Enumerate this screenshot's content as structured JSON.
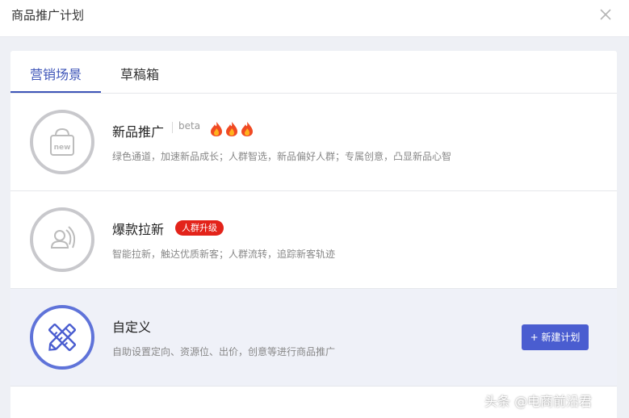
{
  "header": {
    "title": "商品推广计划",
    "close_icon": "close-icon"
  },
  "tabs": [
    {
      "label": "营销场景",
      "active": true
    },
    {
      "label": "草稿箱",
      "active": false
    }
  ],
  "scenarios": [
    {
      "title": "新品推广",
      "tag": "beta",
      "icon": "new-bag-icon",
      "hot_icons": [
        "fire-icon",
        "fire-icon",
        "fire-icon"
      ],
      "desc": "绿色通道，加速新品成长；人群智选，新品偏好人群；专属创意，凸显新品心智"
    },
    {
      "title": "爆款拉新",
      "badge": "人群升级",
      "icon": "user-flow-icon",
      "desc": "智能拉新，触达优质新客；人群流转，追踪新客轨迹"
    },
    {
      "title": "自定义",
      "icon": "pencil-ruler-icon",
      "desc": "自助设置定向、资源位、出价，创意等进行商品推广",
      "button": "+ 新建计划"
    }
  ],
  "colors": {
    "accent": "#3e55b8",
    "button": "#4a5dd0",
    "badge": "#e3231a",
    "selected_row": "#eff1f8"
  },
  "watermark": "头条 @电商前沿君"
}
